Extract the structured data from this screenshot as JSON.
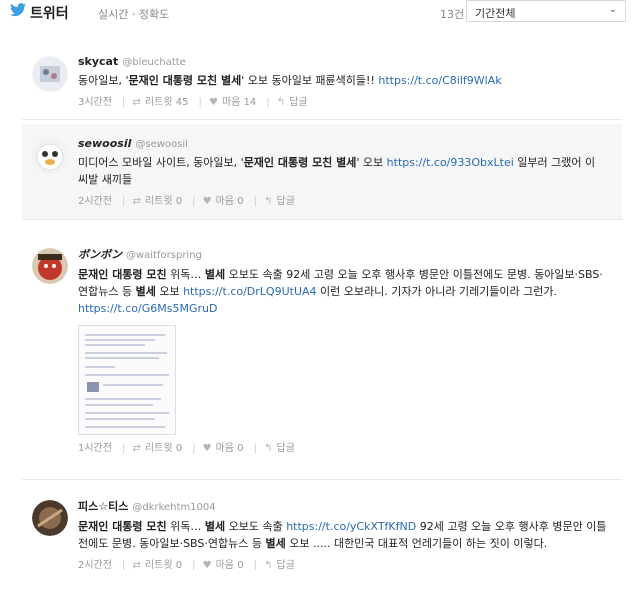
{
  "header": {
    "brand": "트위터",
    "tabs": "실시간 · 정확도",
    "count": "13건",
    "period_select": "기간전체"
  },
  "tweets": [
    {
      "name": "skycat",
      "handle": "@bleuchatte",
      "pre": "동아일보, '",
      "bold": "문재인 대통령 모친 별세",
      "post": "' 오보 동아일보 패륜색히들!! ",
      "link": "https://t.co/C8ilf9WlAk",
      "time": "3시간전",
      "retweets": "리트윗 45",
      "likes": "마음 14",
      "reply": "답글"
    },
    {
      "name": "sewoosil",
      "handle": "@sewoosil",
      "pre": "미디어스 모바일 사이트, 동아일보, '",
      "bold": "문재인 대통령 모친 별세",
      "post": "' 오보 ",
      "link": "https://t.co/933ObxLtei",
      "post2": " 일부러 그랬어 이 씨발 새끼들",
      "time": "2시간전",
      "retweets": "리트윗 0",
      "likes": "마음 0",
      "reply": "답글"
    },
    {
      "name": "ボンボン",
      "handle": "@waitforspring",
      "bold": "문재인 대통령 모친",
      "mid1": " 위독… ",
      "bold2": "별세",
      "mid2": " 오보도 속출 92세 고령 오늘 오후 행사후 병문안 이틀전에도 문병. 동아일보·SBS·연합뉴스 등 ",
      "bold3": "별세",
      "mid3": " 오보 ",
      "link": "https://t.co/DrLQ9UtUA4",
      "mid4": " 이런 오보라니. 기자가 아니라 기레기들이라 그런가. ",
      "link2": "https://t.co/G6Ms5MGruD",
      "time": "1시간전",
      "retweets": "리트윗 0",
      "likes": "마음 0",
      "reply": "답글"
    },
    {
      "name": "피스☆티스",
      "handle": "@dkrkehtm1004",
      "bold": "문재인 대통령 모친",
      "mid1": " 위독… ",
      "bold2": "별세",
      "mid2": " 오보도 속출 ",
      "link": "https://t.co/yCkXTfKfND",
      "mid3": " 92세 고령 오늘 오후 행사후 병문안 이틀전에도 문병. 동아일보·SBS·연합뉴스 등 ",
      "bold3": "별세",
      "mid4": " 오보 ..... 대한민국 대표적 언레기들이 하는 짓이 이렇다.",
      "time": "2시간전",
      "retweets": "리트윗 0",
      "likes": "마음 0",
      "reply": "답글"
    }
  ]
}
